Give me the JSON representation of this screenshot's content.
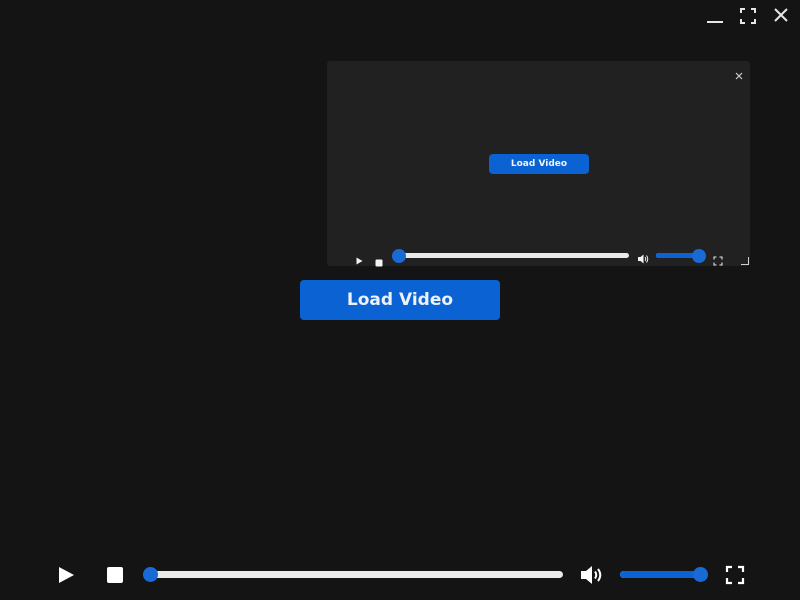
{
  "window_controls": {
    "minimize_icon": "minimize-icon",
    "maximize_icon": "maximize-icon",
    "close_icon": "close-icon"
  },
  "main": {
    "load_button_label": "Load Video"
  },
  "pip_player": {
    "load_button_label": "Load Video",
    "close_icon": "close-icon",
    "progress": 0,
    "volume": 1
  },
  "controls": {
    "play_icon": "play-icon",
    "stop_icon": "stop-icon",
    "volume_icon": "volume-icon",
    "fullscreen_icon": "fullscreen-icon",
    "progress": 0,
    "volume": 1
  },
  "colors": {
    "background": "#141415",
    "panel": "#212122",
    "accent": "#0b63d3",
    "track": "#e9e9e9"
  }
}
